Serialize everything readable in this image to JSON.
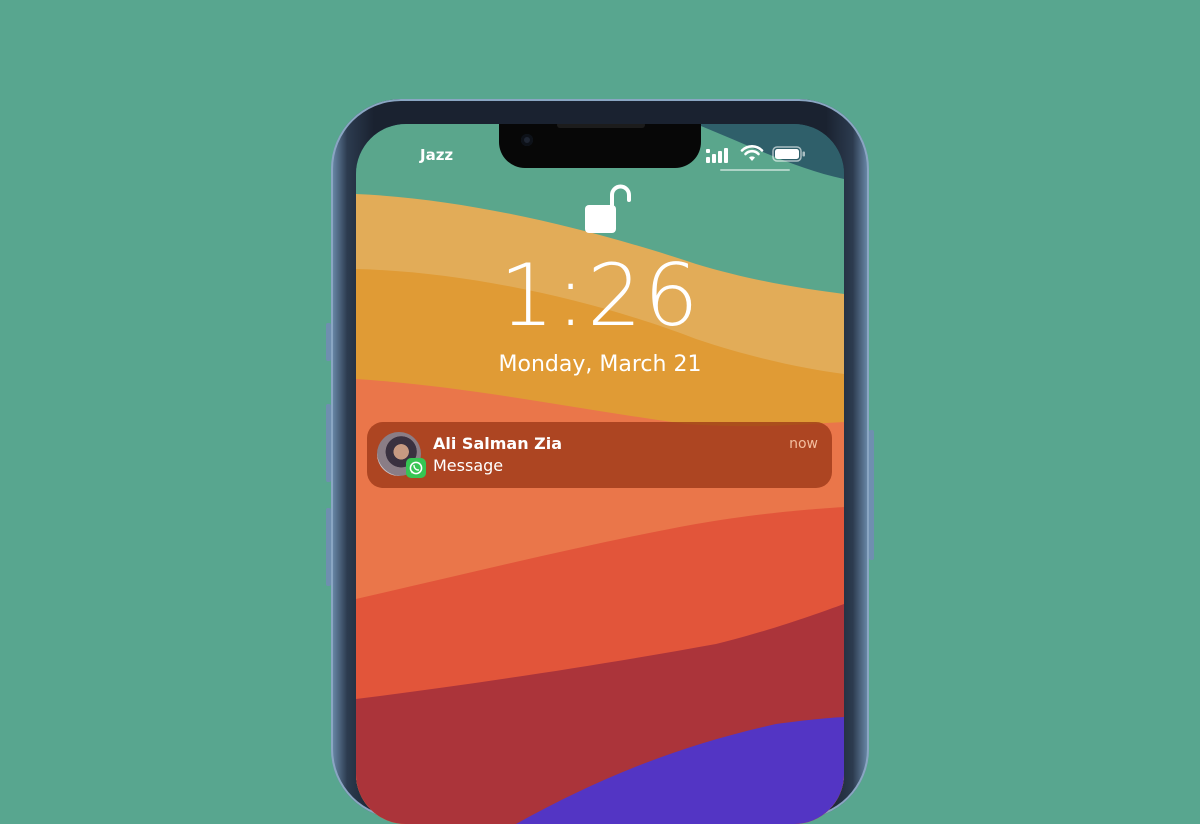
{
  "status_bar": {
    "carrier": "Jazz",
    "signal_icon": "cellular-signal-icon",
    "wifi_icon": "wifi-icon",
    "battery_icon": "battery-icon"
  },
  "lock_screen": {
    "lock_icon": "unlocked-padlock-icon",
    "time": "1:26",
    "date": "Monday, March 21"
  },
  "notification": {
    "sender": "Ali Salman Zia",
    "message": "Message",
    "time": "now",
    "app_icon": "whatsapp-icon"
  },
  "colors": {
    "background": "#58a68f",
    "whatsapp_green": "#36c553",
    "notification_bg": "#963214"
  }
}
